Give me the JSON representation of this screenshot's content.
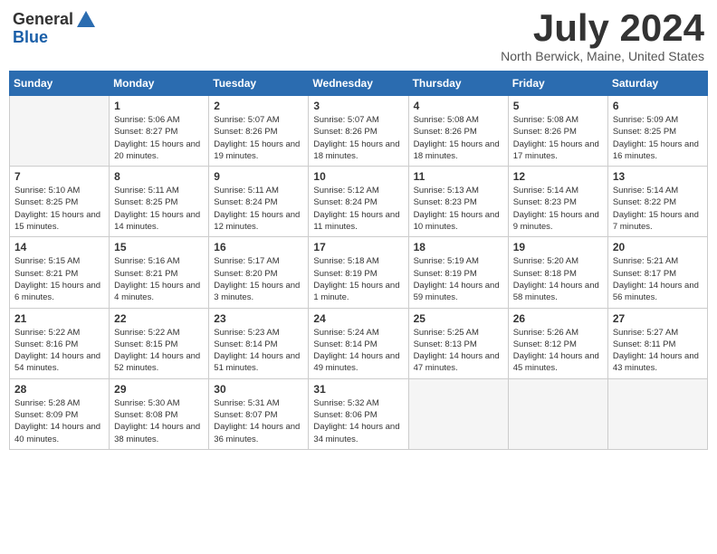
{
  "header": {
    "logo_general": "General",
    "logo_blue": "Blue",
    "month_title": "July 2024",
    "location": "North Berwick, Maine, United States"
  },
  "days_of_week": [
    "Sunday",
    "Monday",
    "Tuesday",
    "Wednesday",
    "Thursday",
    "Friday",
    "Saturday"
  ],
  "weeks": [
    [
      {
        "day": "",
        "empty": true
      },
      {
        "day": "1",
        "sunrise": "Sunrise: 5:06 AM",
        "sunset": "Sunset: 8:27 PM",
        "daylight": "Daylight: 15 hours and 20 minutes."
      },
      {
        "day": "2",
        "sunrise": "Sunrise: 5:07 AM",
        "sunset": "Sunset: 8:26 PM",
        "daylight": "Daylight: 15 hours and 19 minutes."
      },
      {
        "day": "3",
        "sunrise": "Sunrise: 5:07 AM",
        "sunset": "Sunset: 8:26 PM",
        "daylight": "Daylight: 15 hours and 18 minutes."
      },
      {
        "day": "4",
        "sunrise": "Sunrise: 5:08 AM",
        "sunset": "Sunset: 8:26 PM",
        "daylight": "Daylight: 15 hours and 18 minutes."
      },
      {
        "day": "5",
        "sunrise": "Sunrise: 5:08 AM",
        "sunset": "Sunset: 8:26 PM",
        "daylight": "Daylight: 15 hours and 17 minutes."
      },
      {
        "day": "6",
        "sunrise": "Sunrise: 5:09 AM",
        "sunset": "Sunset: 8:25 PM",
        "daylight": "Daylight: 15 hours and 16 minutes."
      }
    ],
    [
      {
        "day": "7",
        "sunrise": "Sunrise: 5:10 AM",
        "sunset": "Sunset: 8:25 PM",
        "daylight": "Daylight: 15 hours and 15 minutes."
      },
      {
        "day": "8",
        "sunrise": "Sunrise: 5:11 AM",
        "sunset": "Sunset: 8:25 PM",
        "daylight": "Daylight: 15 hours and 14 minutes."
      },
      {
        "day": "9",
        "sunrise": "Sunrise: 5:11 AM",
        "sunset": "Sunset: 8:24 PM",
        "daylight": "Daylight: 15 hours and 12 minutes."
      },
      {
        "day": "10",
        "sunrise": "Sunrise: 5:12 AM",
        "sunset": "Sunset: 8:24 PM",
        "daylight": "Daylight: 15 hours and 11 minutes."
      },
      {
        "day": "11",
        "sunrise": "Sunrise: 5:13 AM",
        "sunset": "Sunset: 8:23 PM",
        "daylight": "Daylight: 15 hours and 10 minutes."
      },
      {
        "day": "12",
        "sunrise": "Sunrise: 5:14 AM",
        "sunset": "Sunset: 8:23 PM",
        "daylight": "Daylight: 15 hours and 9 minutes."
      },
      {
        "day": "13",
        "sunrise": "Sunrise: 5:14 AM",
        "sunset": "Sunset: 8:22 PM",
        "daylight": "Daylight: 15 hours and 7 minutes."
      }
    ],
    [
      {
        "day": "14",
        "sunrise": "Sunrise: 5:15 AM",
        "sunset": "Sunset: 8:21 PM",
        "daylight": "Daylight: 15 hours and 6 minutes."
      },
      {
        "day": "15",
        "sunrise": "Sunrise: 5:16 AM",
        "sunset": "Sunset: 8:21 PM",
        "daylight": "Daylight: 15 hours and 4 minutes."
      },
      {
        "day": "16",
        "sunrise": "Sunrise: 5:17 AM",
        "sunset": "Sunset: 8:20 PM",
        "daylight": "Daylight: 15 hours and 3 minutes."
      },
      {
        "day": "17",
        "sunrise": "Sunrise: 5:18 AM",
        "sunset": "Sunset: 8:19 PM",
        "daylight": "Daylight: 15 hours and 1 minute."
      },
      {
        "day": "18",
        "sunrise": "Sunrise: 5:19 AM",
        "sunset": "Sunset: 8:19 PM",
        "daylight": "Daylight: 14 hours and 59 minutes."
      },
      {
        "day": "19",
        "sunrise": "Sunrise: 5:20 AM",
        "sunset": "Sunset: 8:18 PM",
        "daylight": "Daylight: 14 hours and 58 minutes."
      },
      {
        "day": "20",
        "sunrise": "Sunrise: 5:21 AM",
        "sunset": "Sunset: 8:17 PM",
        "daylight": "Daylight: 14 hours and 56 minutes."
      }
    ],
    [
      {
        "day": "21",
        "sunrise": "Sunrise: 5:22 AM",
        "sunset": "Sunset: 8:16 PM",
        "daylight": "Daylight: 14 hours and 54 minutes."
      },
      {
        "day": "22",
        "sunrise": "Sunrise: 5:22 AM",
        "sunset": "Sunset: 8:15 PM",
        "daylight": "Daylight: 14 hours and 52 minutes."
      },
      {
        "day": "23",
        "sunrise": "Sunrise: 5:23 AM",
        "sunset": "Sunset: 8:14 PM",
        "daylight": "Daylight: 14 hours and 51 minutes."
      },
      {
        "day": "24",
        "sunrise": "Sunrise: 5:24 AM",
        "sunset": "Sunset: 8:14 PM",
        "daylight": "Daylight: 14 hours and 49 minutes."
      },
      {
        "day": "25",
        "sunrise": "Sunrise: 5:25 AM",
        "sunset": "Sunset: 8:13 PM",
        "daylight": "Daylight: 14 hours and 47 minutes."
      },
      {
        "day": "26",
        "sunrise": "Sunrise: 5:26 AM",
        "sunset": "Sunset: 8:12 PM",
        "daylight": "Daylight: 14 hours and 45 minutes."
      },
      {
        "day": "27",
        "sunrise": "Sunrise: 5:27 AM",
        "sunset": "Sunset: 8:11 PM",
        "daylight": "Daylight: 14 hours and 43 minutes."
      }
    ],
    [
      {
        "day": "28",
        "sunrise": "Sunrise: 5:28 AM",
        "sunset": "Sunset: 8:09 PM",
        "daylight": "Daylight: 14 hours and 40 minutes."
      },
      {
        "day": "29",
        "sunrise": "Sunrise: 5:30 AM",
        "sunset": "Sunset: 8:08 PM",
        "daylight": "Daylight: 14 hours and 38 minutes."
      },
      {
        "day": "30",
        "sunrise": "Sunrise: 5:31 AM",
        "sunset": "Sunset: 8:07 PM",
        "daylight": "Daylight: 14 hours and 36 minutes."
      },
      {
        "day": "31",
        "sunrise": "Sunrise: 5:32 AM",
        "sunset": "Sunset: 8:06 PM",
        "daylight": "Daylight: 14 hours and 34 minutes."
      },
      {
        "day": "",
        "empty": true
      },
      {
        "day": "",
        "empty": true
      },
      {
        "day": "",
        "empty": true
      }
    ]
  ]
}
